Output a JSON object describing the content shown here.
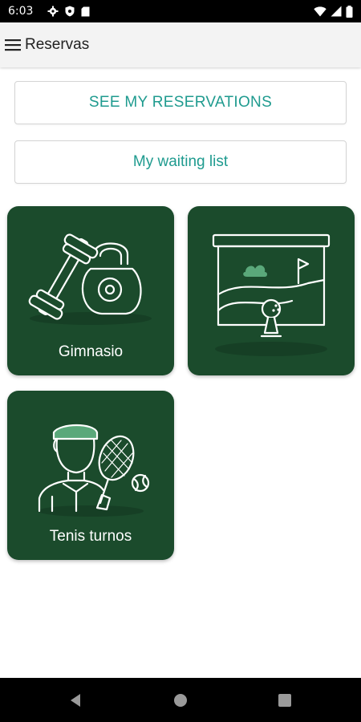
{
  "status_bar": {
    "time": "6:03",
    "icons": [
      "gear-icon",
      "shield-icon",
      "sd-card-icon",
      "wifi-icon",
      "signal-icon",
      "battery-icon"
    ]
  },
  "app_bar": {
    "title": "Reservas",
    "menu_icon": "hamburger-menu-icon"
  },
  "buttons": {
    "see_reservations": "SEE MY RESERVATIONS",
    "waiting_list": "My waiting list"
  },
  "cards": [
    {
      "label": "Gimnasio",
      "icon": "gym-weights-icon"
    },
    {
      "label": "",
      "icon": "golf-simulator-icon"
    },
    {
      "label": "Tenis turnos",
      "icon": "tennis-player-icon"
    }
  ],
  "colors": {
    "card_background": "#1b4b2c",
    "button_text": "#1f9b8f",
    "status_bar": "#000000",
    "app_bar": "#f3f3f3"
  },
  "nav_bar": {
    "icons": [
      "back-icon",
      "home-icon",
      "recents-icon"
    ]
  }
}
